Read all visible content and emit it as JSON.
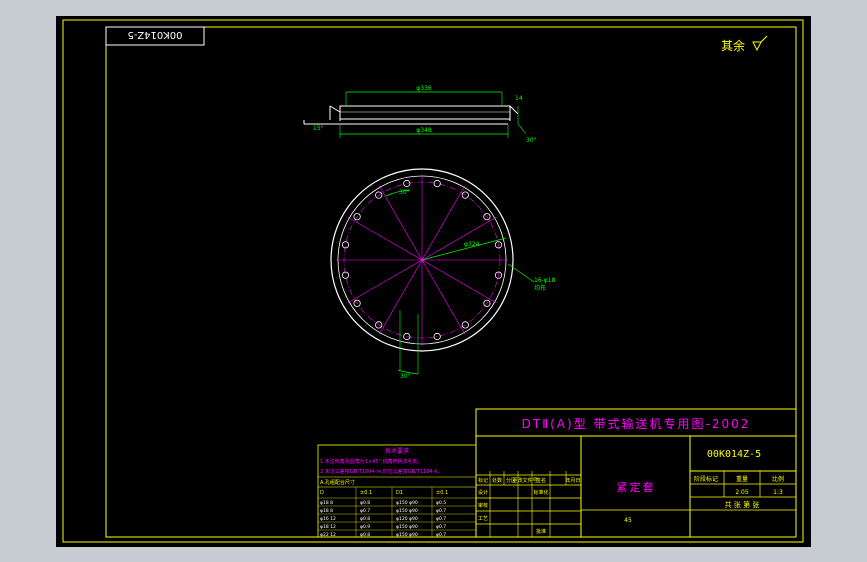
{
  "drawing_code": "00K014Z-5",
  "drawing_code_mirrored": "00K014Z-5",
  "surface_finish": "其余",
  "title_block": {
    "series_title": "DTⅡ(A)型  带式输送机专用图-2002",
    "part_name": "紧定套",
    "code": "00K014Z-5",
    "scale": "1:3",
    "weight": "2.05",
    "sheet_note": "共  张  第  张",
    "labels": {
      "stage_mark": "阶段标记",
      "weight": "重量",
      "scale": "比例",
      "sheets": "共   张   第   张",
      "mark": "标记",
      "count": "处数",
      "zone": "分区",
      "doc_no": "更改文件号",
      "sign": "签名",
      "date": "年月日",
      "design": "设计",
      "standard": "标准化",
      "check": "审核",
      "craft": "工艺",
      "approve": "批准",
      "material": "45"
    }
  },
  "tech_requirements": {
    "heading": "技术要求",
    "lines": [
      "1.未注倒角及圆角为1×45°,锐角倒钝去毛刺。",
      "2.未注公差按GB/T1804-m,形位公差按GB/T1184-K。"
    ],
    "table_heading": "A.孔组配合尺寸",
    "columns": [
      "D",
      "±0.1",
      "D1",
      "±0.1"
    ],
    "rows": [
      [
        "φ18  8",
        "φ0.8",
        "φ150  φ90",
        "φ0.5"
      ],
      [
        "φ18  8",
        "φ0.7",
        "φ150  φ90",
        "φ0.7"
      ],
      [
        "φ16  12",
        "φ0.8",
        "φ120  φ90",
        "φ0.7"
      ],
      [
        "φ18  12",
        "φ0.9",
        "φ150  φ90",
        "φ0.7"
      ],
      [
        "φ22  12",
        "φ0.8",
        "φ150  φ90",
        "φ0.7"
      ]
    ]
  },
  "dimensions": {
    "top_width": "φ336",
    "bottom_width": "φ348",
    "thickness": "14",
    "chamfer_left": "15°",
    "chamfer_right": "30°",
    "bolt_circle": "φ324",
    "angle_top": "30°",
    "angle_bottom": "30°",
    "hole_callout": "16-φ18",
    "hole_callout_sub": "均布"
  },
  "colors": {
    "frame": "#ffff00",
    "outline": "#ffffff",
    "dimension": "#00ff00",
    "centerline": "#ff00ff",
    "text": "#ffff00"
  }
}
